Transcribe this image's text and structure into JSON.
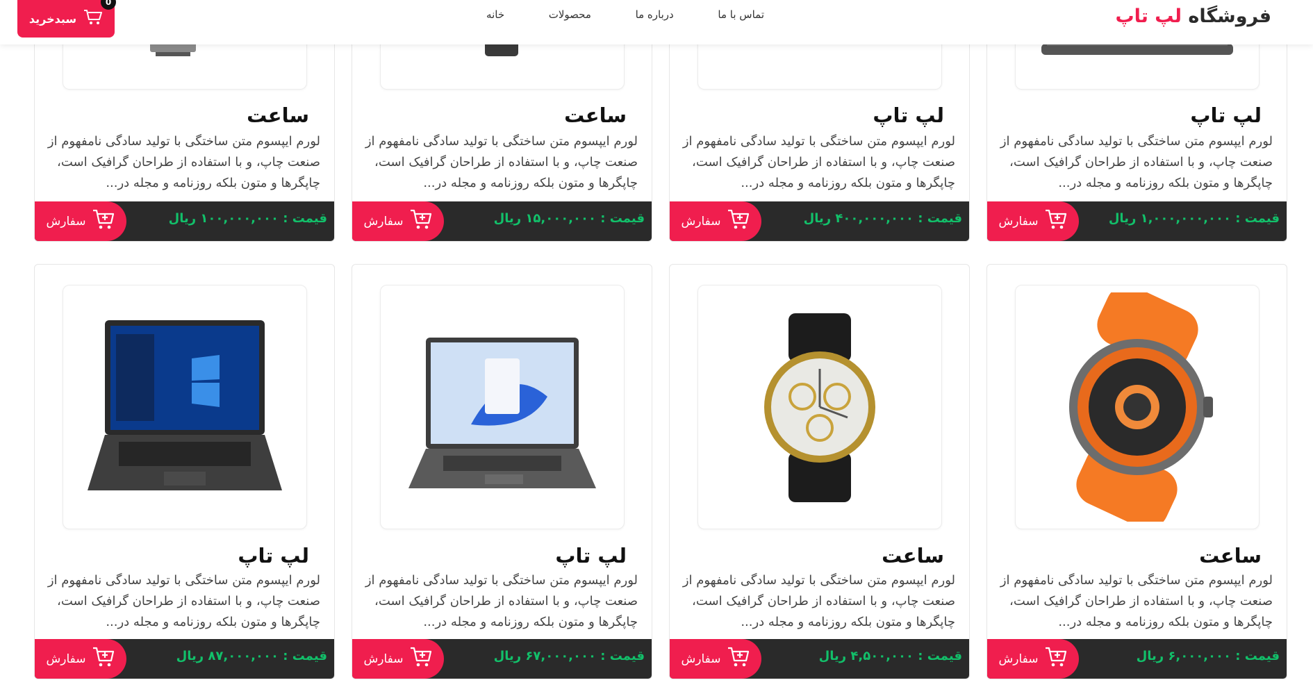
{
  "header": {
    "logo_part1": "فروشگاه",
    "logo_part2": "لپ تاپ",
    "nav": [
      "خانه",
      "محصولات",
      "درباره ما",
      "تماس با ما"
    ],
    "cart_label": "سبدخرید",
    "cart_count": "0"
  },
  "description": "لورم ایپسوم متن ساختگی با تولید سادگی نامفهوم از صنعت چاپ، و با استفاده از طراحان گرافیک است، چاپگرها و متون بلکه روزنامه و مجله در...",
  "order_label": "سفارش",
  "price_prefix": "قیمت :",
  "currency": "ریال",
  "products_row1": [
    {
      "title": "لپ تاپ",
      "price": "۱,۰۰۰,۰۰۰,۰۰۰",
      "image": "laptop-image"
    },
    {
      "title": "لپ تاپ",
      "price": "۴۰۰,۰۰۰,۰۰۰",
      "image": "laptop-image"
    },
    {
      "title": "ساعت",
      "price": "۱۵,۰۰۰,۰۰۰",
      "image": "watch-image"
    },
    {
      "title": "ساعت",
      "price": "۱۰۰,۰۰۰,۰۰۰",
      "image": "watch-image"
    }
  ],
  "products_row2": [
    {
      "title": "ساعت",
      "price": "۶,۰۰۰,۰۰۰",
      "image": "orange-smartwatch-image"
    },
    {
      "title": "ساعت",
      "price": "۴,۵۰۰,۰۰۰",
      "image": "gold-watch-image"
    },
    {
      "title": "لپ تاپ",
      "price": "۶۷,۰۰۰,۰۰۰",
      "image": "laptop-windows11-image"
    },
    {
      "title": "لپ تاپ",
      "price": "۸۷,۰۰۰,۰۰۰",
      "image": "laptop-windows10-image"
    }
  ],
  "colors": {
    "accent": "#f01e4e",
    "price": "#12c06a",
    "bar": "#2a2a2a"
  }
}
